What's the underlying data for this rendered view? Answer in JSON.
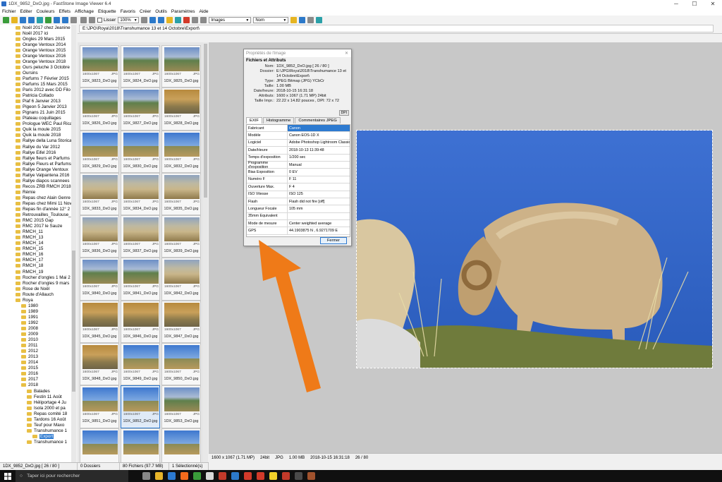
{
  "window": {
    "title": "1DX_9852_DxO.jpg  -  FastStone Image Viewer 6.4",
    "min": "─",
    "max": "☐",
    "close": "✕"
  },
  "menu": [
    "Fichier",
    "Editer",
    "Couleurs",
    "Effets",
    "Affichage",
    "Etiquette",
    "Favoris",
    "Créer",
    "Outils",
    "Paramètres",
    "Aide"
  ],
  "toolbar": {
    "lisser_label": "Lisser",
    "zoom": "100%",
    "type_filter": "Images",
    "sort": "Nom",
    "path": "E:\\JPG\\Roya\\2018\\Transhumance 13 et 14 Octobre\\Export\\"
  },
  "tree": [
    {
      "label": "Noël 2017 chez Jeanine",
      "depth": 0
    },
    {
      "label": "Noël 2017 ici",
      "depth": 0
    },
    {
      "label": "Ongles 29 Mars 2015",
      "depth": 0
    },
    {
      "label": "Orange Ventoux 2014",
      "depth": 0
    },
    {
      "label": "Orange Ventoux 2015",
      "depth": 0
    },
    {
      "label": "Orange Ventoux 2016",
      "depth": 0
    },
    {
      "label": "Orange Ventoux 2018",
      "depth": 0
    },
    {
      "label": "Ours peluche 3 Octobre",
      "depth": 0
    },
    {
      "label": "Oursins",
      "depth": 0
    },
    {
      "label": "Parfums 7 Février 2015",
      "depth": 0
    },
    {
      "label": "Parfums 15 Mars 2015",
      "depth": 0
    },
    {
      "label": "Paris 2012 avec DD Filo",
      "depth": 0
    },
    {
      "label": "Patricia Collado",
      "depth": 0
    },
    {
      "label": "Piaf 6 Janvier 2013",
      "depth": 0
    },
    {
      "label": "Pigeon 5 Janvier 2013",
      "depth": 0
    },
    {
      "label": "Pignans 21 Juin 2015",
      "depth": 0
    },
    {
      "label": "Plateau coquillages",
      "depth": 0
    },
    {
      "label": "Prologue WEC Paul Ricard",
      "depth": 0
    },
    {
      "label": "Quik la moule 2015",
      "depth": 0
    },
    {
      "label": "Quik la moule 2018",
      "depth": 0
    },
    {
      "label": "Rallye della Luna Storica",
      "depth": 0
    },
    {
      "label": "Rallye du Var 2012",
      "depth": 0
    },
    {
      "label": "Rallye Eifel 2016",
      "depth": 0
    },
    {
      "label": "Rallye fleurs et Parfums",
      "depth": 0
    },
    {
      "label": "Rallye Fleurs et Parfums",
      "depth": 0
    },
    {
      "label": "Rallye Orange Ventoux",
      "depth": 0
    },
    {
      "label": "Rallye Valpantena 2016",
      "depth": 0
    },
    {
      "label": "Rallye diapos scannees",
      "depth": 0
    },
    {
      "label": "Recos ZRB RMCH 2018",
      "depth": 0
    },
    {
      "label": "Rémie",
      "depth": 0
    },
    {
      "label": "Repas chez Alain Genre",
      "depth": 0
    },
    {
      "label": "Repas chez Mimi 11 Nov",
      "depth": 0
    },
    {
      "label": "Repas fin d'année 12° 2",
      "depth": 0
    },
    {
      "label": "Retrouvailles_Toulouse_",
      "depth": 0
    },
    {
      "label": "RMC 2015 Gap",
      "depth": 0
    },
    {
      "label": "RMC 2017 le Sauze",
      "depth": 0
    },
    {
      "label": "RMCH_11",
      "depth": 0
    },
    {
      "label": "RMCH_13",
      "depth": 0
    },
    {
      "label": "RMCH_14",
      "depth": 0
    },
    {
      "label": "RMCH_15",
      "depth": 0
    },
    {
      "label": "RMCH_16",
      "depth": 0
    },
    {
      "label": "RMCH_17",
      "depth": 0
    },
    {
      "label": "RMCH_18",
      "depth": 0
    },
    {
      "label": "RMCH_19",
      "depth": 0
    },
    {
      "label": "Rocher d'ongles 1 Mai 2",
      "depth": 0
    },
    {
      "label": "Rocher d'ongles 9 mars",
      "depth": 0
    },
    {
      "label": "Rose de Noël",
      "depth": 0
    },
    {
      "label": "Route d'Allauch",
      "depth": 0
    },
    {
      "label": "Roya",
      "depth": 0
    },
    {
      "label": "1980",
      "depth": 1
    },
    {
      "label": "1989",
      "depth": 1
    },
    {
      "label": "1991",
      "depth": 1
    },
    {
      "label": "1992",
      "depth": 1
    },
    {
      "label": "2008",
      "depth": 1
    },
    {
      "label": "2009",
      "depth": 1
    },
    {
      "label": "2010",
      "depth": 1
    },
    {
      "label": "2011",
      "depth": 1
    },
    {
      "label": "2012",
      "depth": 1
    },
    {
      "label": "2013",
      "depth": 1
    },
    {
      "label": "2014",
      "depth": 1
    },
    {
      "label": "2015",
      "depth": 1
    },
    {
      "label": "2016",
      "depth": 1
    },
    {
      "label": "2017",
      "depth": 1
    },
    {
      "label": "2018",
      "depth": 1
    },
    {
      "label": "Balades",
      "depth": 2
    },
    {
      "label": "Festin 11 Août",
      "depth": 2
    },
    {
      "label": "Héliportage 4 Ju",
      "depth": 2
    },
    {
      "label": "Isola 2000 et pa",
      "depth": 2
    },
    {
      "label": "Repas comité 18",
      "depth": 2
    },
    {
      "label": "Tardons 16 Août",
      "depth": 2
    },
    {
      "label": "Teuf pour Maxo",
      "depth": 2
    },
    {
      "label": "Transhumance 1",
      "depth": 2
    },
    {
      "label": "Export",
      "depth": 3,
      "selected": true
    },
    {
      "label": "Transhumance 1",
      "depth": 2
    }
  ],
  "thumbs": [
    {
      "name": "1DX_9823_DxO.jpg",
      "dim": "1600x1067",
      "ext": "JPG",
      "v": "v-mtn"
    },
    {
      "name": "1DX_9824_DxO.jpg",
      "dim": "1600x1067",
      "ext": "JPG",
      "v": "v-mtn"
    },
    {
      "name": "1DX_9825_DxO.jpg",
      "dim": "1600x1067",
      "ext": "JPG",
      "v": "v-mtn"
    },
    {
      "name": "1DX_9826_DxO.jpg",
      "dim": "1600x1067",
      "ext": "JPG",
      "v": "v-mtn"
    },
    {
      "name": "1DX_9827_DxO.jpg",
      "dim": "1600x1067",
      "ext": "JPG",
      "v": "v-mtn"
    },
    {
      "name": "1DX_9828_DxO.jpg",
      "dim": "1600x1067",
      "ext": "JPG",
      "v": "v-fall"
    },
    {
      "name": "1DX_9829_DxO.jpg",
      "dim": "1600x1067",
      "ext": "JPG",
      "v": "v-sky"
    },
    {
      "name": "1DX_9830_DxO.jpg",
      "dim": "1600x1067",
      "ext": "JPG",
      "v": "v-sky"
    },
    {
      "name": "1DX_9832_DxO.jpg",
      "dim": "1600x1067",
      "ext": "JPG",
      "v": "v-sky"
    },
    {
      "name": "1DX_9833_DxO.jpg",
      "dim": "1600x1067",
      "ext": "JPG",
      "v": "v-herd"
    },
    {
      "name": "1DX_9834_DxO.jpg",
      "dim": "1600x1067",
      "ext": "JPG",
      "v": "v-herd"
    },
    {
      "name": "1DX_9835_DxO.jpg",
      "dim": "1600x1067",
      "ext": "JPG",
      "v": "v-herd"
    },
    {
      "name": "1DX_9836_DxO.jpg",
      "dim": "1600x1067",
      "ext": "JPG",
      "v": "v-herd"
    },
    {
      "name": "1DX_9837_DxO.jpg",
      "dim": "1600x1067",
      "ext": "JPG",
      "v": "v-herd"
    },
    {
      "name": "1DX_9839_DxO.jpg",
      "dim": "1600x1067",
      "ext": "JPG",
      "v": "v-herd"
    },
    {
      "name": "1DX_9840_DxO.jpg",
      "dim": "1600x1067",
      "ext": "JPG",
      "v": "v-mtn"
    },
    {
      "name": "1DX_9841_DxO.jpg",
      "dim": "1600x1067",
      "ext": "JPG",
      "v": "v-mtn"
    },
    {
      "name": "1DX_9842_DxO.jpg",
      "dim": "1600x1067",
      "ext": "JPG",
      "v": "v-herd"
    },
    {
      "name": "1DX_9845_DxO.jpg",
      "dim": "1600x1067",
      "ext": "JPG",
      "v": "v-fall"
    },
    {
      "name": "1DX_9846_DxO.jpg",
      "dim": "1600x1067",
      "ext": "JPG",
      "v": "v-fall"
    },
    {
      "name": "1DX_9847_DxO.jpg",
      "dim": "1600x1067",
      "ext": "JPG",
      "v": "v-fall"
    },
    {
      "name": "1DX_9848_DxO.jpg",
      "dim": "1600x1067",
      "ext": "JPG",
      "v": "v-fall"
    },
    {
      "name": "1DX_9849_DxO.jpg",
      "dim": "1600x1067",
      "ext": "JPG",
      "v": "v-sky"
    },
    {
      "name": "1DX_9850_DxO.jpg",
      "dim": "1600x1067",
      "ext": "JPG",
      "v": "v-sky"
    },
    {
      "name": "1DX_9851_DxO.jpg",
      "dim": "1600x1067",
      "ext": "JPG",
      "v": "v-sky"
    },
    {
      "name": "1DX_9852_DxO.jpg",
      "dim": "1600x1067",
      "ext": "JPG",
      "v": "v-sky",
      "selected": true
    },
    {
      "name": "1DX_9853_DxO.jpg",
      "dim": "1600x1067",
      "ext": "JPG",
      "v": "v-mtn"
    },
    {
      "name": "",
      "dim": "",
      "ext": "",
      "v": "v-sky"
    },
    {
      "name": "",
      "dim": "",
      "ext": "",
      "v": "v-sky"
    },
    {
      "name": "",
      "dim": "",
      "ext": "",
      "v": "v-sky"
    }
  ],
  "status": {
    "file": "1DX_9852_DxO.jpg [ 26 / 80 ]",
    "folders": "0 Dossiers",
    "files": "80 Fichiers (97.7 MB)",
    "selected": "1 Sélectionné(s)"
  },
  "info": {
    "dims": "1600 x 1067 (1.71 MP)",
    "bits": "24bit",
    "ext": "JPG",
    "size": "1.00 MB",
    "date": "2018-10-15 16:31:18",
    "pos": "26 / 80"
  },
  "dialog": {
    "title": "Propriétés de l'image",
    "section": "Fichiers et Attributs",
    "attrs": [
      {
        "k": "Nom:",
        "v": "1DX_9852_DxO.jpg  [ 26 / 80 ]"
      },
      {
        "k": "Dossier:",
        "v": "E:\\JPG\\Roya\\2018\\Transhumance 13 et 14 Octobre\\Export\\"
      },
      {
        "k": "Type:",
        "v": "JPEG Bitmap (JPG) YCbCr"
      },
      {
        "k": "Taille:",
        "v": "1.00 MB"
      },
      {
        "k": "Date/heure:",
        "v": "2018-10-15 16:31:18"
      },
      {
        "k": "Attributs:",
        "v": "1600 x 1067 (1.71 MP)  24bit"
      },
      {
        "k": "Taille Impr.:",
        "v": "22.22 x 14.82 pouces ,  DPI: 72 x 72"
      }
    ],
    "dpi_btn": "DPI",
    "tabs": [
      "EXIF",
      "Histogramme",
      "Commentaires JPEG"
    ],
    "exif": [
      {
        "k": "Fabricant",
        "v": "Canon"
      },
      {
        "k": "Modèle",
        "v": "Canon EOS-1D X"
      },
      {
        "k": "Logiciel",
        "v": "Adobe Photoshop Lightroom Classic 7"
      },
      {
        "k": "Date/Heure",
        "v": "2018-10-13 11:39:48"
      },
      {
        "k": "Temps d'exposition",
        "v": "1/200 sec"
      },
      {
        "k": "Programme d'exposition",
        "v": "Manual"
      },
      {
        "k": "Bias Exposition",
        "v": "0 EV"
      },
      {
        "k": "Numéro F",
        "v": "F 11"
      },
      {
        "k": "Ouverture Max.",
        "v": "F 4"
      },
      {
        "k": "ISO Vitesse",
        "v": "ISO 125"
      },
      {
        "k": "Flash",
        "v": "Flash did not fire [off]"
      },
      {
        "k": "Longueur Focale",
        "v": "105 mm"
      },
      {
        "k": "35mm Equivalent",
        "v": ""
      },
      {
        "k": "Mode de mesure",
        "v": "Center weighted average"
      },
      {
        "k": "GPS",
        "v": "44.1903875 N ,  6.9271709 E"
      }
    ],
    "close_label": "Fermer"
  },
  "taskbar": {
    "search_placeholder": "Taper ici pour rechercher"
  },
  "colors": {
    "accent": "#2d7ad0",
    "arrow": "#ef7a18",
    "sky": "#2f61c4"
  }
}
